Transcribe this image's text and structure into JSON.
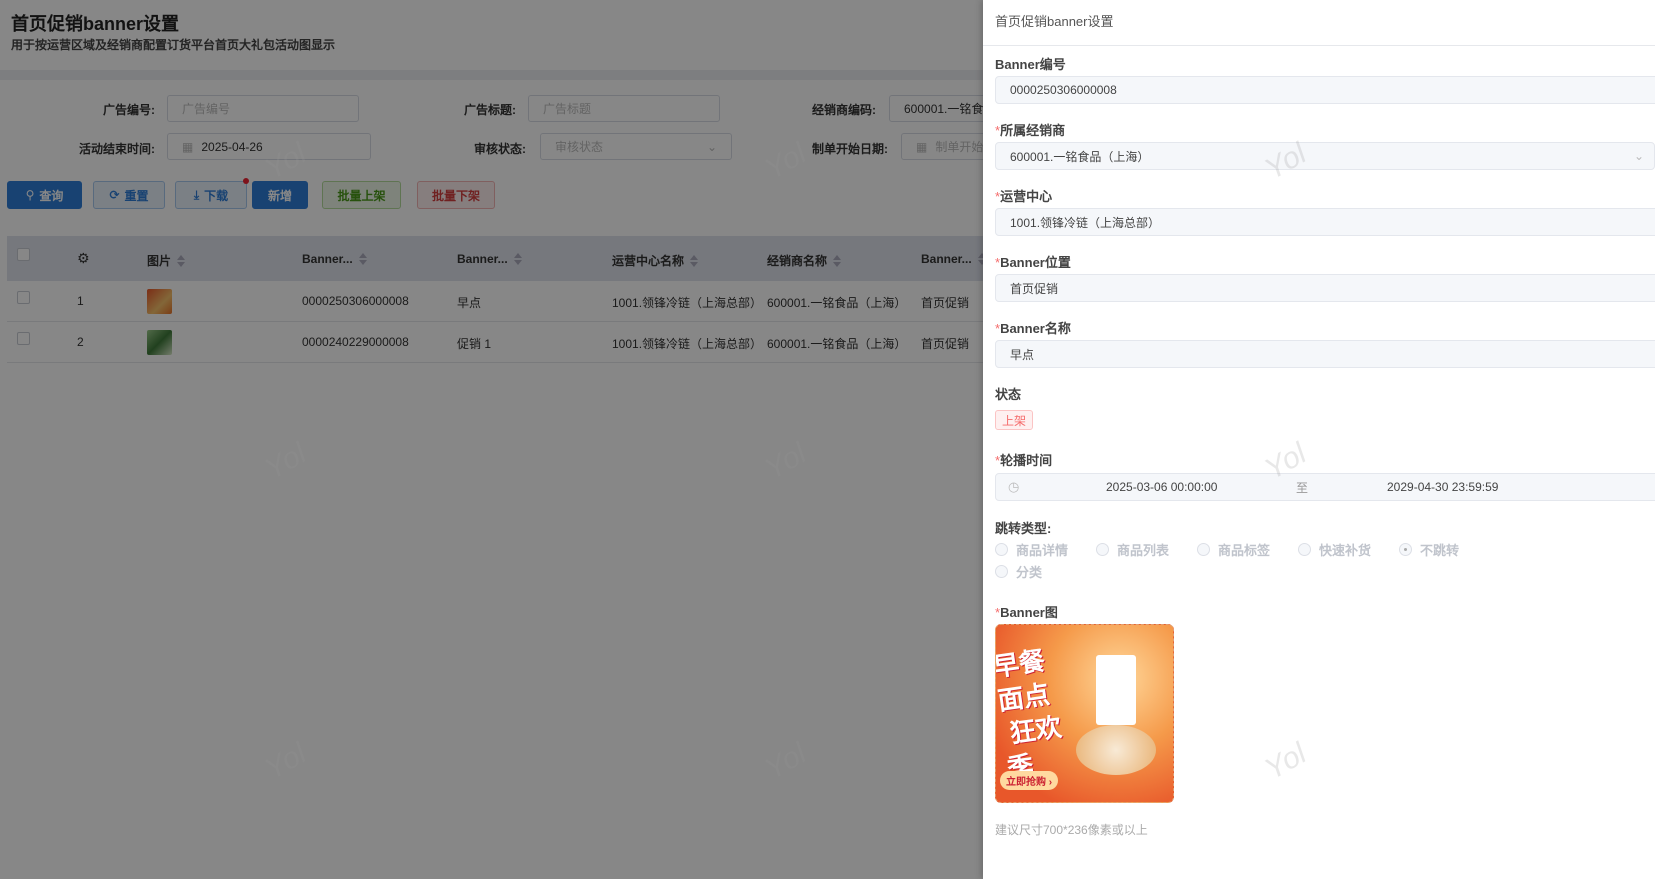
{
  "page": {
    "title": "首页促销banner设置",
    "subtitle": "用于按运营区域及经销商配置订货平台首页大礼包活动图显示"
  },
  "filters": {
    "ad_no": {
      "label": "广告编号:",
      "placeholder": "广告编号"
    },
    "ad_title": {
      "label": "广告标题:",
      "placeholder": "广告标题"
    },
    "dealer_code": {
      "label": "经销商编码:",
      "value": "600001.一铭食"
    },
    "end_date": {
      "label": "活动结束时间:",
      "value": "2025-04-26"
    },
    "audit_status": {
      "label": "审核状态:",
      "placeholder": "审核状态"
    },
    "start_date": {
      "label": "制单开始日期:",
      "placeholder": "制单开始日期"
    }
  },
  "toolbar": {
    "query": "查询",
    "reset": "重置",
    "download": "下载",
    "add": "新增",
    "batch_on": "批量上架",
    "batch_off": "批量下架"
  },
  "table": {
    "columns": [
      "图片",
      "Banner...",
      "Banner...",
      "运营中心名称",
      "经销商名称",
      "Banner..."
    ],
    "rows": [
      {
        "idx": "1",
        "code": "0000250306000008",
        "name": "早点",
        "center": "1001.领锋冷链（上海总部）",
        "dealer": "600001.一铭食品（上海）",
        "position": "首页促销"
      },
      {
        "idx": "2",
        "code": "0000240229000008",
        "name": "促销 1",
        "center": "1001.领锋冷链（上海总部）",
        "dealer": "600001.一铭食品（上海）",
        "position": "首页促销"
      }
    ]
  },
  "watermark": "Yol",
  "drawer": {
    "title": "首页促销banner设置",
    "banner_no": {
      "label": "Banner编号",
      "value": "0000250306000008"
    },
    "dealer": {
      "label": "所属经销商",
      "value": "600001.一铭食品（上海）"
    },
    "center": {
      "label": "运营中心",
      "value": "1001.领锋冷链（上海总部）"
    },
    "position": {
      "label": "Banner位置",
      "value": "首页促销"
    },
    "name": {
      "label": "Banner名称",
      "value": "早点"
    },
    "status": {
      "label": "状态",
      "value": "上架"
    },
    "time": {
      "label": "轮播时间",
      "start": "2025-03-06 00:00:00",
      "sep": "至",
      "end": "2029-04-30 23:59:59"
    },
    "jump": {
      "label": "跳转类型:",
      "options": [
        "商品详情",
        "商品列表",
        "商品标签",
        "快速补货",
        "不跳转",
        "分类"
      ],
      "selected": "不跳转"
    },
    "image": {
      "label": "Banner图",
      "logo_text": "早餐面点 狂欢季",
      "button_text": "立即抢购",
      "hint": "建议尺寸700*236像素或以上"
    },
    "required_mark": "*"
  },
  "colors": {
    "primary": "#2f7ed8",
    "danger": "#f56c6c",
    "success": "#4a9a1a"
  }
}
